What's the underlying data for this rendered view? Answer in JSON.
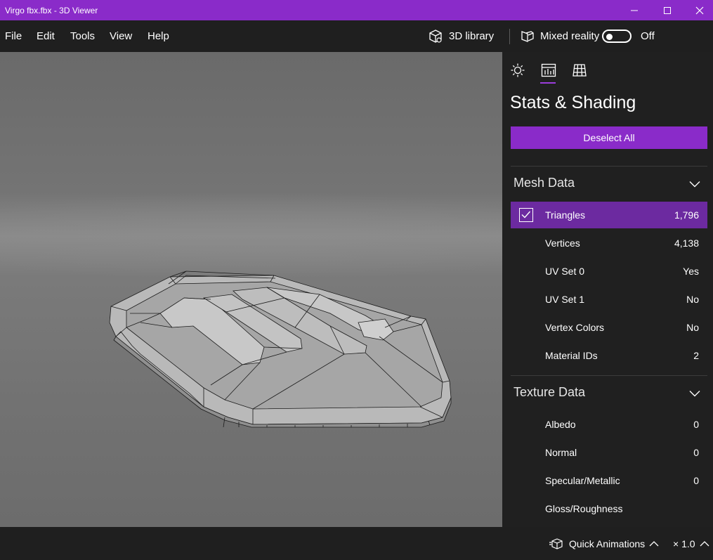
{
  "window": {
    "title": "Virgo fbx.fbx - 3D Viewer"
  },
  "menu": {
    "items": [
      "File",
      "Edit",
      "Tools",
      "View",
      "Help"
    ]
  },
  "toolbar": {
    "library_label": "3D library",
    "mixed_reality_label": "Mixed reality",
    "mixed_reality_state": "Off"
  },
  "panel": {
    "tabs": [
      "lighting",
      "stats-shading",
      "grid"
    ],
    "active_tab": "stats-shading",
    "title": "Stats & Shading",
    "deselect_label": "Deselect All",
    "mesh_section": {
      "title": "Mesh Data",
      "rows": [
        {
          "label": "Triangles",
          "value": "1,796",
          "checked": true
        },
        {
          "label": "Vertices",
          "value": "4,138"
        },
        {
          "label": "UV Set 0",
          "value": "Yes"
        },
        {
          "label": "UV Set 1",
          "value": "No"
        },
        {
          "label": "Vertex Colors",
          "value": "No"
        },
        {
          "label": "Material IDs",
          "value": "2"
        }
      ]
    },
    "texture_section": {
      "title": "Texture Data",
      "rows": [
        {
          "label": "Albedo",
          "value": "0"
        },
        {
          "label": "Normal",
          "value": "0"
        },
        {
          "label": "Specular/Metallic",
          "value": "0"
        },
        {
          "label": "Gloss/Roughness",
          "value": ""
        }
      ]
    }
  },
  "bottom": {
    "quick_animations_label": "Quick Animations",
    "speed_label": "× 1.0"
  },
  "colors": {
    "accent": "#8a2bc9",
    "selected_row": "#6c2aa0",
    "panel_bg": "#202020"
  }
}
